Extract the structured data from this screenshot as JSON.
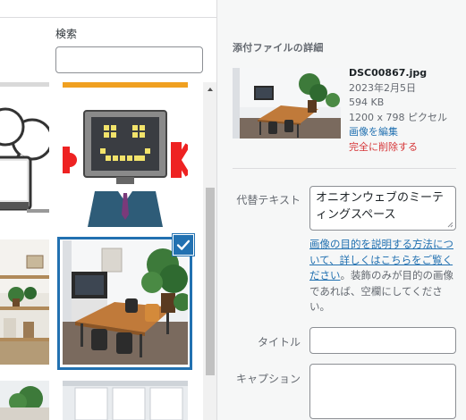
{
  "search": {
    "label": "検索",
    "value": ""
  },
  "grid": {
    "items": [
      {
        "name": "chat-bubbles-illustration"
      },
      {
        "name": "orange-strip-image"
      },
      {
        "name": "monitor-robot-illustration"
      },
      {
        "name": "office-shelves-photo"
      },
      {
        "name": "office-meeting-space-photo",
        "selected": true
      },
      {
        "name": "office-plant-photo"
      },
      {
        "name": "office-window-photo"
      }
    ]
  },
  "details": {
    "heading": "添付ファイルの詳細",
    "filename": "DSC00867.jpg",
    "date": "2023年2月5日",
    "size": "594 KB",
    "dimensions": "1200 x 798 ピクセル",
    "edit_link": "画像を編集",
    "delete_link": "完全に削除する"
  },
  "fields": {
    "alt_label": "代替テキスト",
    "alt_value": "オニオンウェブのミーティングスペース",
    "help_link": "画像の目的を説明する方法について、詳しくはこちらをご覧ください",
    "help_suffix": "。装飾のみが目的の画像であれば、空欄にしてください。",
    "title_label": "タイトル",
    "title_value": "",
    "caption_label": "キャプション",
    "caption_value": ""
  },
  "colors": {
    "accent": "#2271b1",
    "delete": "#d63638",
    "sidebar_bg": "#f6f7f7"
  }
}
